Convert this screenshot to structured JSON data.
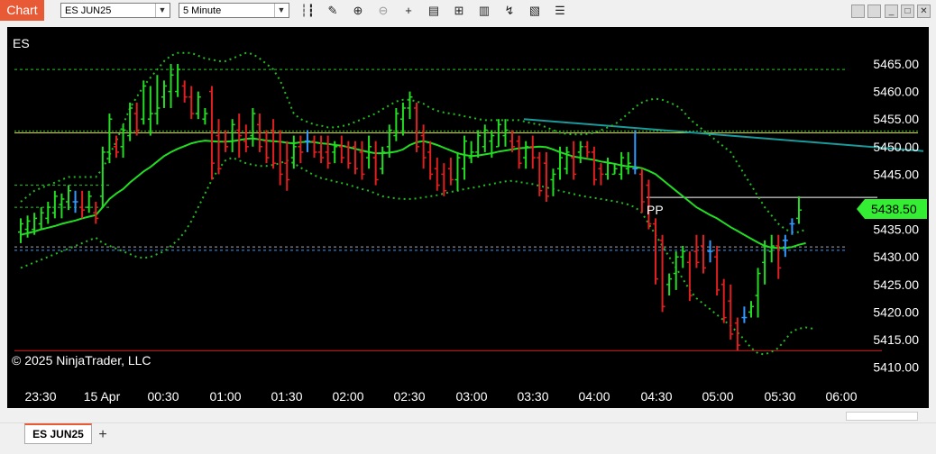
{
  "window": {
    "title": "Chart"
  },
  "toolbar": {
    "instrument": "ES JUN25",
    "interval": "5 Minute",
    "icons": [
      "bar-type-icon",
      "pencil-icon",
      "zoom-in-icon",
      "zoom-out-icon",
      "crosshair-icon",
      "data-box-icon",
      "chart-trader-icon",
      "indicators-icon",
      "strategies-icon",
      "templates-icon",
      "properties-icon"
    ]
  },
  "chart": {
    "instrument_label": "ES",
    "copyright": "© 2025 NinjaTrader, LLC",
    "pivot_label": "PP",
    "last_price": "5438.50"
  },
  "tabs": {
    "active": "ES JUN25",
    "add": "+"
  },
  "colors": {
    "up": "#22dd22",
    "down": "#e02020",
    "flat": "#3399ff",
    "sma": "#22dd22",
    "bands": "#22bb22",
    "background": "#000000",
    "trendline": "#1a9a9a",
    "marker": "#33ee33"
  },
  "chart_data": {
    "type": "candlestick",
    "y_axis": {
      "ticks": [
        "5465.00",
        "5460.00",
        "5455.00",
        "5450.00",
        "5445.00",
        "5440.00",
        "5435.00",
        "5430.00",
        "5425.00",
        "5420.00",
        "5415.00",
        "5410.00"
      ],
      "range": [
        5408.5,
        5468.5
      ]
    },
    "x_axis": {
      "ticks": [
        "23:30",
        "15 Apr",
        "00:30",
        "01:00",
        "01:30",
        "02:00",
        "02:30",
        "03:00",
        "03:30",
        "04:00",
        "04:30",
        "05:00",
        "05:30",
        "06:00"
      ]
    },
    "bars": [
      [
        5434.5,
        5437,
        5432.5,
        5436
      ],
      [
        5435,
        5437.5,
        5433.5,
        5436.5
      ],
      [
        5435,
        5438,
        5434,
        5437
      ],
      [
        5436,
        5439,
        5435,
        5438
      ],
      [
        5437,
        5440,
        5436,
        5439
      ],
      [
        5438,
        5442,
        5437,
        5441
      ],
      [
        5439.5,
        5441.5,
        5437,
        5440.5
      ],
      [
        5440,
        5443,
        5438.5,
        5442
      ],
      [
        5440,
        5442,
        5438,
        5440
      ],
      [
        5439,
        5442,
        5437,
        5438.5
      ],
      [
        5439,
        5442,
        5438,
        5441
      ],
      [
        5438,
        5440,
        5436,
        5437
      ],
      [
        5441,
        5450,
        5439,
        5449
      ],
      [
        5449,
        5456,
        5447,
        5455
      ],
      [
        5450,
        5452,
        5448,
        5449
      ],
      [
        5450,
        5454,
        5448,
        5453
      ],
      [
        5452,
        5458,
        5451,
        5457
      ],
      [
        5456,
        5458,
        5452,
        5453
      ],
      [
        5455,
        5462,
        5454,
        5461
      ],
      [
        5455,
        5461,
        5452,
        5456
      ],
      [
        5456,
        5463,
        5454,
        5457
      ],
      [
        5459,
        5462,
        5457,
        5461
      ],
      [
        5460,
        5465,
        5457,
        5463
      ],
      [
        5460,
        5465,
        5459,
        5464
      ],
      [
        5461,
        5462,
        5458,
        5459
      ],
      [
        5459,
        5461,
        5455,
        5456
      ],
      [
        5456,
        5460,
        5455,
        5459
      ],
      [
        5455,
        5457,
        5454,
        5456
      ],
      [
        5460,
        5461,
        5444,
        5447
      ],
      [
        5452,
        5455,
        5445,
        5446
      ],
      [
        5451,
        5453,
        5449,
        5450
      ],
      [
        5451,
        5455,
        5449,
        5454
      ],
      [
        5453,
        5456,
        5448,
        5452
      ],
      [
        5451,
        5454,
        5449,
        5450
      ],
      [
        5452,
        5457,
        5450,
        5456
      ],
      [
        5454,
        5456,
        5449,
        5450
      ],
      [
        5451,
        5453,
        5447,
        5448
      ],
      [
        5453,
        5455,
        5446,
        5447
      ],
      [
        5451,
        5453,
        5443,
        5445
      ],
      [
        5447,
        5451,
        5442,
        5444
      ],
      [
        5448,
        5452,
        5446,
        5450
      ],
      [
        5450,
        5452,
        5447,
        5449
      ],
      [
        5451,
        5453,
        5449,
        5451
      ],
      [
        5451,
        5452,
        5448,
        5449
      ],
      [
        5449,
        5452,
        5447,
        5448
      ],
      [
        5449,
        5452,
        5446,
        5447
      ],
      [
        5449,
        5451,
        5447,
        5450
      ],
      [
        5450,
        5452,
        5447,
        5448
      ],
      [
        5450,
        5451,
        5446,
        5447
      ],
      [
        5450,
        5451,
        5445,
        5446
      ],
      [
        5449,
        5451,
        5444,
        5445
      ],
      [
        5448,
        5452,
        5446,
        5450
      ],
      [
        5448,
        5451,
        5443,
        5444
      ],
      [
        5446,
        5450,
        5445,
        5449
      ],
      [
        5450,
        5454,
        5448,
        5453
      ],
      [
        5452,
        5457,
        5451,
        5456
      ],
      [
        5455,
        5458,
        5452,
        5457
      ],
      [
        5457,
        5460,
        5455,
        5459
      ],
      [
        5457,
        5458,
        5449,
        5450
      ],
      [
        5452,
        5454,
        5446,
        5448
      ],
      [
        5449,
        5451,
        5444,
        5445
      ],
      [
        5446,
        5448,
        5442,
        5443
      ],
      [
        5445,
        5447,
        5441,
        5442
      ],
      [
        5446,
        5448,
        5443,
        5444
      ],
      [
        5444,
        5449,
        5442,
        5448
      ],
      [
        5446,
        5452,
        5444,
        5451
      ],
      [
        5448,
        5451,
        5447,
        5449
      ],
      [
        5449,
        5453,
        5448,
        5452
      ],
      [
        5450,
        5454,
        5449,
        5453
      ],
      [
        5451,
        5453,
        5448,
        5452
      ],
      [
        5450,
        5455,
        5450,
        5454
      ],
      [
        5452,
        5455,
        5450,
        5453
      ],
      [
        5451,
        5453,
        5449,
        5450
      ],
      [
        5451,
        5452,
        5446,
        5447
      ],
      [
        5448,
        5451,
        5446,
        5450
      ],
      [
        5450,
        5452,
        5446,
        5448
      ],
      [
        5448,
        5449,
        5441,
        5442
      ],
      [
        5447,
        5449,
        5440,
        5441
      ],
      [
        5444,
        5446,
        5441,
        5445
      ],
      [
        5446,
        5450,
        5444,
        5448
      ],
      [
        5446,
        5450,
        5445,
        5449
      ],
      [
        5448,
        5451,
        5444,
        5445
      ],
      [
        5449,
        5451,
        5447,
        5450
      ],
      [
        5450,
        5451,
        5448,
        5449
      ],
      [
        5449,
        5450,
        5443,
        5444
      ],
      [
        5446,
        5447,
        5443,
        5445
      ],
      [
        5445,
        5448,
        5444,
        5447
      ],
      [
        5445,
        5447,
        5445,
        5446
      ],
      [
        5445,
        5449,
        5444,
        5448
      ],
      [
        5446,
        5449,
        5445,
        5447
      ],
      [
        5446,
        5453,
        5445,
        5446
      ],
      [
        5445,
        5446,
        5438,
        5440
      ],
      [
        5443,
        5444,
        5435,
        5436
      ],
      [
        5436,
        5437,
        5425,
        5426
      ],
      [
        5433,
        5434,
        5420,
        5421
      ],
      [
        5425,
        5427,
        5423,
        5426
      ],
      [
        5427,
        5431,
        5424,
        5430
      ],
      [
        5430,
        5432,
        5428,
        5431
      ],
      [
        5429,
        5431,
        5422,
        5423
      ],
      [
        5431,
        5434,
        5428,
        5429
      ],
      [
        5432,
        5434,
        5427,
        5428
      ],
      [
        5431,
        5433,
        5429,
        5431
      ],
      [
        5430,
        5432,
        5423,
        5424
      ],
      [
        5425,
        5426,
        5418,
        5419
      ],
      [
        5422,
        5425,
        5415,
        5416
      ],
      [
        5418,
        5419,
        5413,
        5414
      ],
      [
        5419,
        5421,
        5418,
        5419
      ],
      [
        5420,
        5422,
        5419,
        5421
      ],
      [
        5423,
        5428,
        5419,
        5427
      ],
      [
        5429,
        5433,
        5425,
        5432
      ],
      [
        5431,
        5434,
        5429,
        5432
      ],
      [
        5432,
        5434,
        5426,
        5428
      ],
      [
        5433,
        5434,
        5430,
        5433
      ],
      [
        5436,
        5437,
        5434,
        5436
      ],
      [
        5437,
        5441,
        5436,
        5438.5
      ]
    ],
    "sma": [
      5434,
      5434.3,
      5434.6,
      5435,
      5435.3,
      5435.6,
      5436,
      5436.3,
      5436.6,
      5437,
      5437.3,
      5437.6,
      5439,
      5440.5,
      5441.5,
      5442.3,
      5443.5,
      5444.5,
      5445.5,
      5446.3,
      5447.3,
      5448.3,
      5449,
      5449.6,
      5450.1,
      5450.6,
      5450.9,
      5451.1,
      5451,
      5450.9,
      5450.9,
      5451,
      5451.2,
      5451.4,
      5451.5,
      5451.3,
      5451.1,
      5451,
      5450.9,
      5450.7,
      5450.6,
      5450.8,
      5450.9,
      5450.8,
      5450.6,
      5450.5,
      5450.3,
      5450.2,
      5449.9,
      5449.6,
      5449.3,
      5449,
      5448.8,
      5448.8,
      5448.9,
      5449.1,
      5449.5,
      5450.3,
      5450.8,
      5451,
      5450.7,
      5450.3,
      5449.8,
      5449.3,
      5448.8,
      5448.5,
      5448.3,
      5448.4,
      5448.6,
      5448.8,
      5449.1,
      5449.3,
      5449.5,
      5449.7,
      5449.8,
      5449.9,
      5450,
      5449.9,
      5449.5,
      5449,
      5448.6,
      5448.2,
      5448,
      5447.8,
      5447.6,
      5447.3,
      5447.1,
      5446.9,
      5446.6,
      5446.4,
      5446.3,
      5446.1,
      5445.6,
      5445,
      5444,
      5443,
      5442,
      5441,
      5440,
      5439,
      5438.3,
      5437.6,
      5437,
      5436.2,
      5435.4,
      5434.7,
      5434,
      5433.3,
      5432.6,
      5432,
      5431.7,
      5431.6,
      5431.6,
      5431.8,
      5432.2,
      5432.5
    ],
    "bands_upper": [
      5440,
      5441,
      5442,
      5442.5,
      5443,
      5443.5,
      5444,
      5444.5,
      5444.5,
      5444.5,
      5444.5,
      5444.5,
      5446,
      5448.5,
      5451,
      5454,
      5457,
      5459,
      5461,
      5462.5,
      5464,
      5465.5,
      5466.5,
      5467,
      5467,
      5467,
      5466.5,
      5466,
      5465.8,
      5465.5,
      5465.5,
      5466,
      5466.5,
      5467,
      5466.8,
      5466,
      5465,
      5464,
      5462,
      5459,
      5456,
      5455,
      5454.5,
      5454,
      5453.8,
      5453.5,
      5453.5,
      5453.7,
      5454,
      5454.5,
      5455,
      5455.5,
      5456,
      5456.8,
      5457.5,
      5458.2,
      5458.5,
      5458.5,
      5458.2,
      5457.8,
      5457,
      5456.5,
      5456.2,
      5456,
      5455.8,
      5455.5,
      5455.3,
      5455,
      5454.8,
      5454.8,
      5454.8,
      5454.8,
      5454.8,
      5454.8,
      5454.5,
      5454.2,
      5454,
      5453.5,
      5453,
      5452.5,
      5452.3,
      5452.2,
      5452.2,
      5452.3,
      5452.5,
      5453,
      5453.5,
      5454,
      5455,
      5456,
      5457.2,
      5458,
      5458.5,
      5458.7,
      5458.5,
      5458,
      5457.5,
      5456.5,
      5455,
      5454,
      5453,
      5452,
      5451,
      5450,
      5449,
      5447,
      5445,
      5443,
      5441,
      5439,
      5437.5,
      5436,
      5435,
      5434.5,
      5434.5,
      5435
    ],
    "bands_lower": [
      5428,
      5428.5,
      5429,
      5429.5,
      5430,
      5430.5,
      5431,
      5431.5,
      5432,
      5432.5,
      5433,
      5433.5,
      5432.5,
      5432,
      5431.5,
      5431,
      5430.5,
      5430,
      5429.8,
      5430,
      5430.5,
      5431,
      5432,
      5433,
      5434.5,
      5436.5,
      5439,
      5441.5,
      5444,
      5446,
      5447.5,
      5448,
      5447.5,
      5447,
      5446.7,
      5446.5,
      5446.5,
      5446.7,
      5447,
      5447.5,
      5447,
      5446.2,
      5445.5,
      5444.8,
      5444.3,
      5444,
      5443.7,
      5443.4,
      5443.1,
      5442.7,
      5442.3,
      5442,
      5441.5,
      5441,
      5440.8,
      5440.6,
      5440.5,
      5440.5,
      5440.6,
      5440.8,
      5441,
      5441.2,
      5441.5,
      5441.8,
      5442,
      5442.3,
      5442.5,
      5442.7,
      5443,
      5443.2,
      5443.5,
      5443.7,
      5443.8,
      5443.6,
      5443.4,
      5443.2,
      5442.9,
      5442.6,
      5442.3,
      5442,
      5441.7,
      5441.4,
      5441.1,
      5440.9,
      5440.7,
      5440.5,
      5440.3,
      5440.1,
      5439.8,
      5439.5,
      5439,
      5438,
      5436,
      5434,
      5432,
      5430,
      5428,
      5426,
      5424,
      5422.5,
      5421.5,
      5420.5,
      5419.5,
      5418.5,
      5417.5,
      5416.3,
      5415,
      5413.5,
      5412.5,
      5412.3,
      5412.8,
      5413.5,
      5415,
      5416.5,
      5417,
      5417.2,
      5417
    ]
  }
}
